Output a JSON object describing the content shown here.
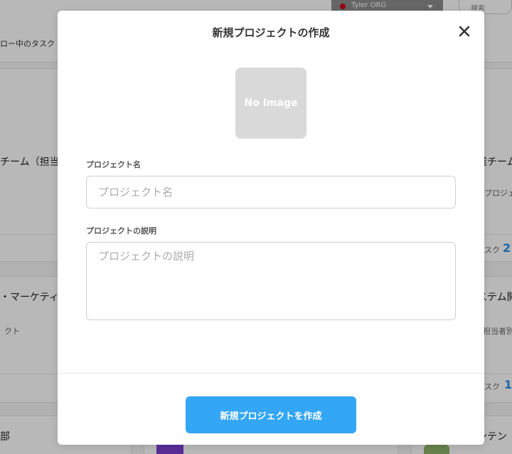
{
  "header": {
    "org_name": "Tyler ORG",
    "search_label": "検索"
  },
  "subnav": {
    "text": "ロー中のタスク"
  },
  "background_cards": {
    "card1_title": "チーム（担当",
    "card2_title": "業チーム",
    "card2_sub": "プロジェ",
    "card2_count_label": "スク",
    "card2_count": "2",
    "card3_title": "・マーケティ",
    "card3_sub": "クト",
    "card4_title": "ステム開",
    "card4_sub": "担当者別",
    "card4_count_label": "スク",
    "card4_count": "1",
    "card5_title": "部",
    "card6_title": "ンテン"
  },
  "modal": {
    "title": "新規プロジェクトの作成",
    "image_placeholder": "No Image",
    "name_label": "プロジェクト名",
    "name_placeholder": "プロジェクト名",
    "name_value": "",
    "description_label": "プロジェクトの説明",
    "description_placeholder": "プロジェクトの説明",
    "description_value": "",
    "create_button": "新規プロジェクトを作成"
  },
  "colors": {
    "primary_button": "#33a6f5",
    "count_accent": "#2a8de6",
    "org_status_dot": "#d0021b"
  },
  "icons": {
    "close": "close-icon",
    "dropdown": "chevron-down-icon",
    "org_status": "status-dot-icon"
  }
}
